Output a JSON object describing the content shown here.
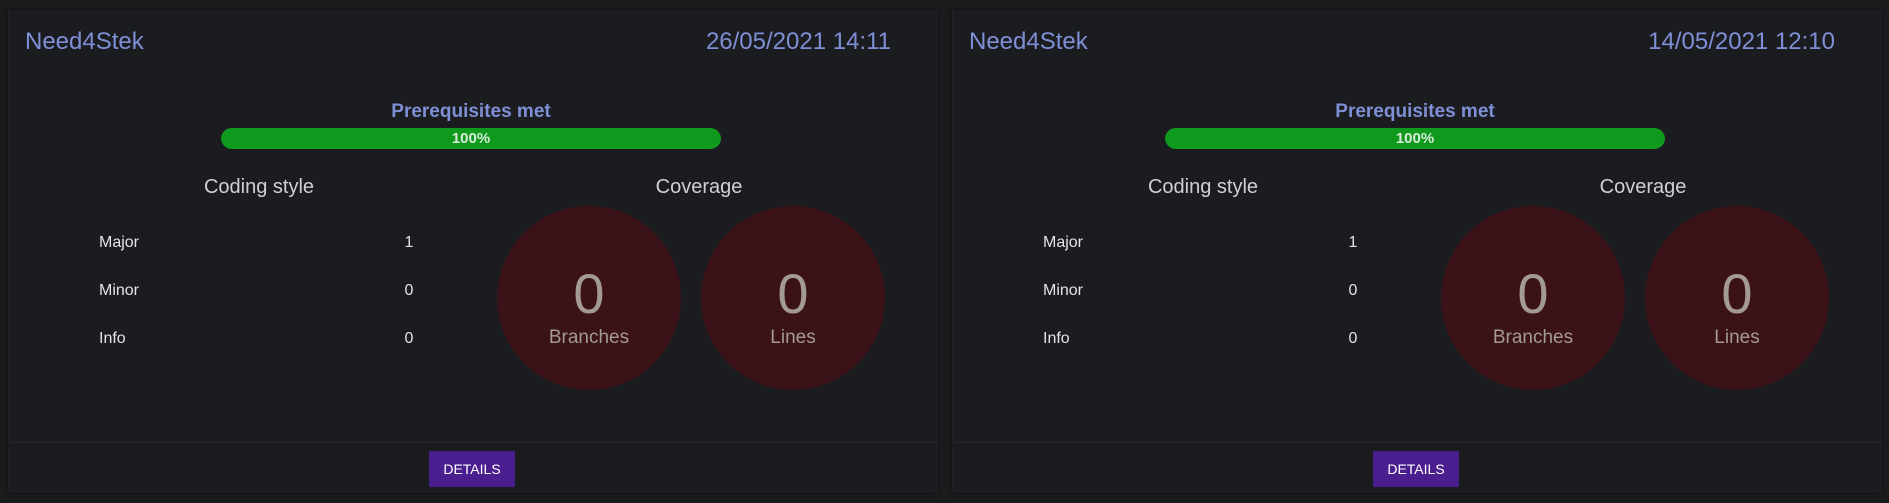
{
  "cards": [
    {
      "title": "Need4Stek",
      "date": "26/05/2021 14:11",
      "prerequisites": {
        "label": "Prerequisites met",
        "percent_text": "100%",
        "fill": 1.0
      },
      "coding_style": {
        "title": "Coding style",
        "rows": [
          {
            "label": "Major",
            "value": "1"
          },
          {
            "label": "Minor",
            "value": "0"
          },
          {
            "label": "Info",
            "value": "0"
          }
        ]
      },
      "coverage": {
        "title": "Coverage",
        "branches": {
          "value": "0",
          "label": "Branches"
        },
        "lines": {
          "value": "0",
          "label": "Lines"
        }
      },
      "details_label": "DETAILS"
    },
    {
      "title": "Need4Stek",
      "date": "14/05/2021 12:10",
      "prerequisites": {
        "label": "Prerequisites met",
        "percent_text": "100%",
        "fill": 1.0
      },
      "coding_style": {
        "title": "Coding style",
        "rows": [
          {
            "label": "Major",
            "value": "1"
          },
          {
            "label": "Minor",
            "value": "0"
          },
          {
            "label": "Info",
            "value": "0"
          }
        ]
      },
      "coverage": {
        "title": "Coverage",
        "branches": {
          "value": "0",
          "label": "Branches"
        },
        "lines": {
          "value": "0",
          "label": "Lines"
        }
      },
      "details_label": "DETAILS"
    }
  ],
  "colors": {
    "accent": "#7f8fd6",
    "progress": "#0f9a1e",
    "coverage_circle": "#3b1217",
    "button": "#4a1e8f"
  }
}
